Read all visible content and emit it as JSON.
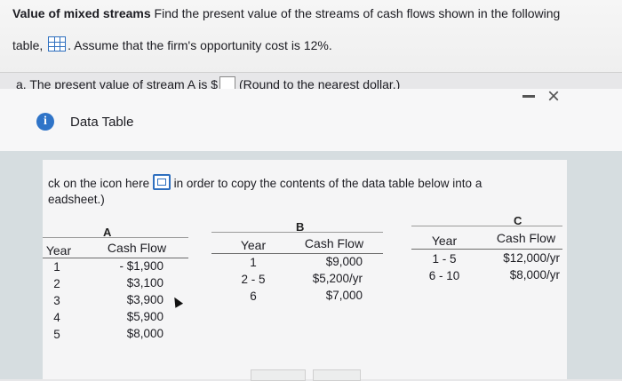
{
  "question": {
    "title_bold": "Value of mixed streams",
    "text1": " Find the present value of the streams of cash flows shown in the following",
    "text2a": "table,",
    "text2b": ". Assume that the firm's opportunity cost is 12%."
  },
  "part_a": {
    "prefix": "a.",
    "text": "The present value of stream A is $",
    "note": "(Round to the nearest dollar.)"
  },
  "dialog": {
    "title": "Data Table",
    "copy_text1": "ck on the icon here",
    "copy_text2": " in order to copy the contents of the data table below into a",
    "copy_text3": "eadsheet.)"
  },
  "table": {
    "letters": [
      "A",
      "B",
      "C"
    ],
    "year_label_a": "Year",
    "year_label": "Year",
    "cash_label": "Cash Flow",
    "a_years": [
      "1",
      "2",
      "3",
      "4",
      "5"
    ],
    "a_cash": [
      "- $1,900",
      "$3,100",
      "$3,900",
      "$5,900",
      "$8,000"
    ],
    "b_years": [
      "1",
      "2 - 5",
      "6"
    ],
    "b_cash": [
      "$9,000",
      "$5,200/yr",
      "$7,000"
    ],
    "c_years": [
      "1 - 5",
      "6 - 10"
    ],
    "c_cash": [
      "$12,000/yr",
      "$8,000/yr"
    ]
  }
}
